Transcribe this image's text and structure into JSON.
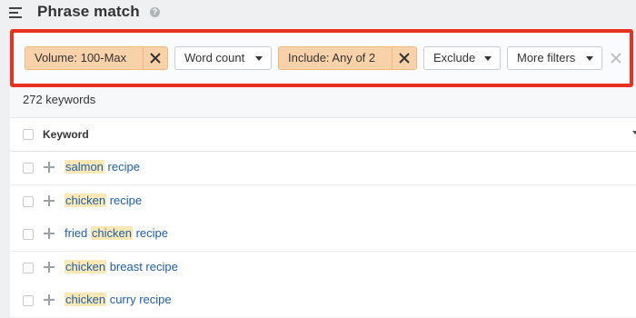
{
  "header": {
    "title": "Phrase match",
    "help_icon": "help-icon"
  },
  "filters": {
    "volume": "Volume: 100-Max",
    "word_count": "Word count",
    "include": "Include: Any of 2",
    "exclude": "Exclude",
    "more_filters": "More filters"
  },
  "results": {
    "count_text": "272 keywords",
    "column_keyword": "Keyword"
  },
  "rows": [
    {
      "parts": [
        {
          "t": "salmon",
          "hl": true
        },
        {
          "t": " recipe",
          "hl": false
        }
      ]
    },
    {
      "parts": [
        {
          "t": "chicken",
          "hl": true
        },
        {
          "t": " recipe",
          "hl": false
        }
      ]
    },
    {
      "parts": [
        {
          "t": "fried ",
          "hl": false
        },
        {
          "t": "chicken",
          "hl": true
        },
        {
          "t": " recipe",
          "hl": false
        }
      ]
    },
    {
      "parts": [
        {
          "t": "chicken",
          "hl": true
        },
        {
          "t": " breast recipe",
          "hl": false
        }
      ]
    },
    {
      "parts": [
        {
          "t": "chicken",
          "hl": true
        },
        {
          "t": " curry recipe",
          "hl": false
        }
      ]
    }
  ],
  "colors": {
    "accent_red": "#e8321f",
    "active_chip": "#f9d2a9",
    "link": "#1e5fa8",
    "highlight": "#fbe8b5"
  }
}
